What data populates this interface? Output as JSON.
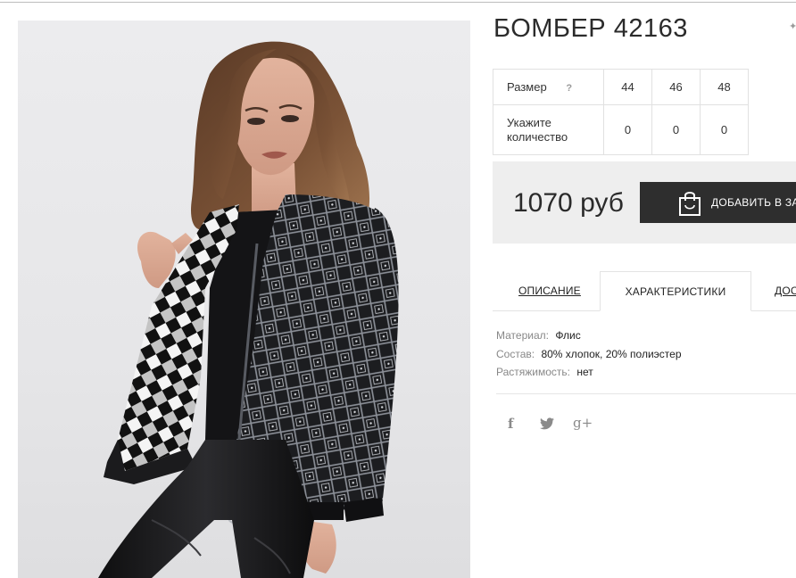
{
  "product": {
    "title": "БОМБЕР 42163",
    "image_alt": "Бомбер 42163"
  },
  "sizes": {
    "size_label": "Размер",
    "help_label": "?",
    "qty_label_line1": "Укажите",
    "qty_label_line2": "количество",
    "options": [
      {
        "size": "44",
        "qty": "0"
      },
      {
        "size": "46",
        "qty": "0"
      },
      {
        "size": "48",
        "qty": "0"
      }
    ]
  },
  "price": {
    "value": "1070 руб",
    "cart_label": "ДОБАВИТЬ В ЗАКАЗ"
  },
  "tabs": [
    {
      "label": "ОПИСАНИЕ",
      "active": false
    },
    {
      "label": "ХАРАКТЕРИСТИКИ",
      "active": true
    },
    {
      "label": "ДОСТАВКА",
      "active": false
    }
  ],
  "specs": [
    {
      "key": "Материал:",
      "value": "Флис"
    },
    {
      "key": "Состав:",
      "value": "80% хлопок, 20% полиэстер"
    },
    {
      "key": "Растяжимость:",
      "value": "нет"
    }
  ],
  "social": {
    "facebook": "f",
    "gplus": "g+"
  },
  "colors": {
    "button_bg": "#2e2e2e",
    "price_box_bg": "#eeeeee",
    "border": "#e1e1e1",
    "muted_text": "#888888"
  },
  "icons": [
    "shopping-bag-icon",
    "facebook-icon",
    "twitter-icon",
    "google-plus-icon"
  ]
}
